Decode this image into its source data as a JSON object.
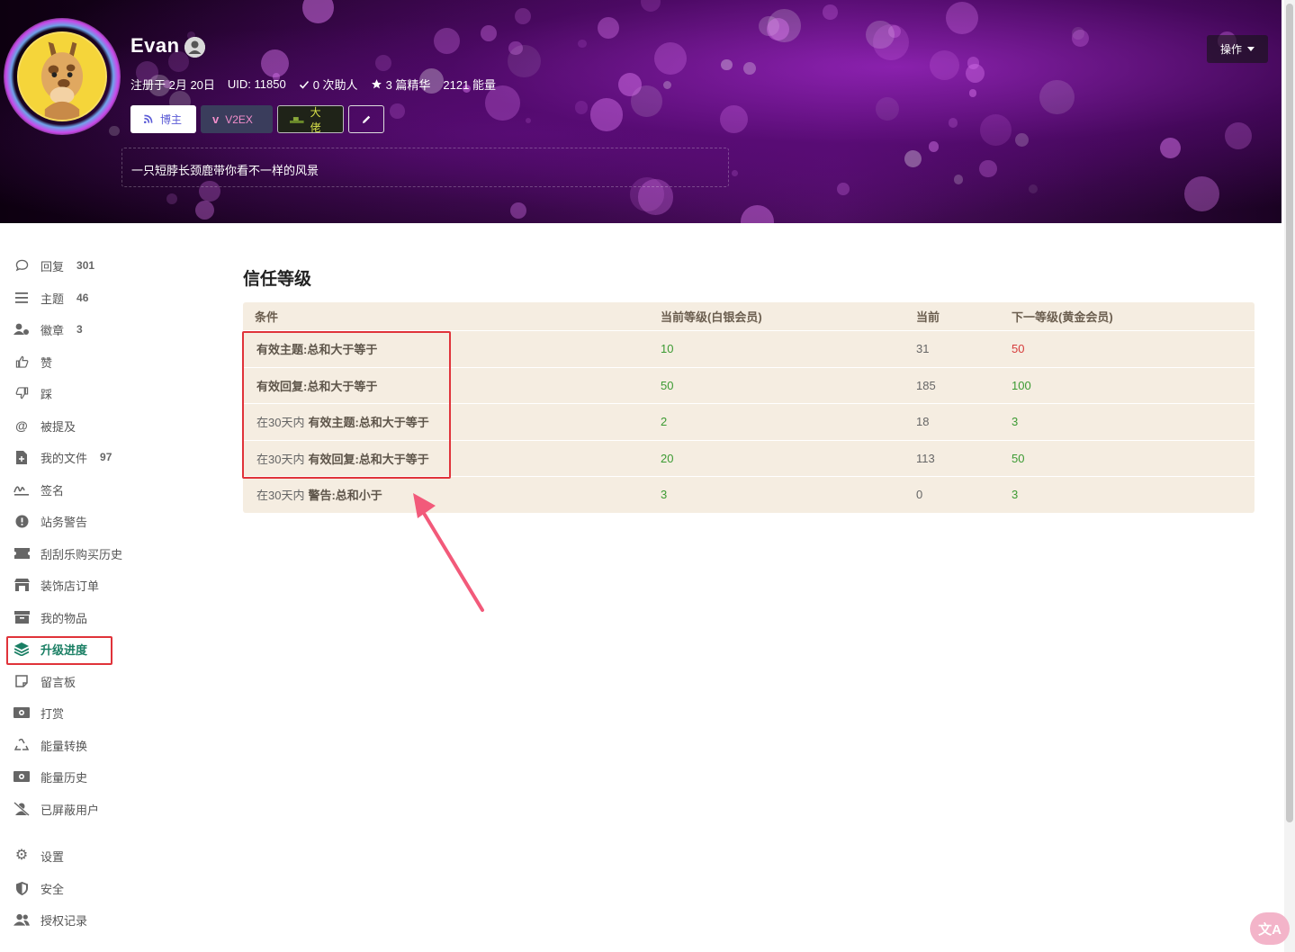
{
  "profile": {
    "name": "Evan",
    "registered": "注册于 2月 20日",
    "uid": "UID: 11850",
    "helped": "0 次助人",
    "featured": "3 篇精华",
    "energy": "2121 能量",
    "bio": "一只短脖长颈鹿带你看不一样的风景",
    "badges": {
      "blogger": "博主",
      "v2ex": "V2EX",
      "boss": "大佬"
    },
    "operations_label": "操作"
  },
  "sidebar": {
    "items": [
      {
        "label": "回复",
        "count": "301",
        "icon": "comment-icon"
      },
      {
        "label": "主题",
        "count": "46",
        "icon": "list-icon"
      },
      {
        "label": "徽章",
        "count": "3",
        "icon": "user-badge-icon"
      },
      {
        "label": "赞",
        "count": "",
        "icon": "thumbs-up-icon"
      },
      {
        "label": "踩",
        "count": "",
        "icon": "thumbs-down-icon"
      },
      {
        "label": "被提及",
        "count": "",
        "icon": "at-icon"
      },
      {
        "label": "我的文件",
        "count": "97",
        "icon": "file-icon"
      },
      {
        "label": "签名",
        "count": "",
        "icon": "signature-icon"
      },
      {
        "label": "站务警告",
        "count": "",
        "icon": "warning-icon"
      },
      {
        "label": "刮刮乐购买历史",
        "count": "",
        "icon": "ticket-icon"
      },
      {
        "label": "装饰店订单",
        "count": "",
        "icon": "store-icon"
      },
      {
        "label": "我的物品",
        "count": "",
        "icon": "box-icon"
      },
      {
        "label": "升级进度",
        "count": "",
        "icon": "layers-icon"
      },
      {
        "label": "留言板",
        "count": "",
        "icon": "note-icon"
      },
      {
        "label": "打赏",
        "count": "",
        "icon": "money-icon"
      },
      {
        "label": "能量转换",
        "count": "",
        "icon": "recycle-icon"
      },
      {
        "label": "能量历史",
        "count": "",
        "icon": "money-history-icon"
      },
      {
        "label": "已屏蔽用户",
        "count": "",
        "icon": "user-block-icon"
      },
      {
        "label": "设置",
        "count": "",
        "icon": "gear-icon"
      },
      {
        "label": "安全",
        "count": "",
        "icon": "shield-icon"
      },
      {
        "label": "授权记录",
        "count": "",
        "icon": "users-icon"
      }
    ],
    "active_index": 12
  },
  "trust": {
    "title": "信任等级",
    "headers": [
      "条件",
      "当前等级(白银会员)",
      "当前",
      "下一等级(黄金会员)"
    ],
    "rows": [
      {
        "prefix": "",
        "condition": "有效主题:总和大于等于",
        "level": "10",
        "current": "31",
        "next": "50",
        "next_color": "#d63b3b"
      },
      {
        "prefix": "",
        "condition": "有效回复:总和大于等于",
        "level": "50",
        "current": "185",
        "next": "100",
        "next_color": "#3b9a32"
      },
      {
        "prefix": "在30天内",
        "condition": "有效主题:总和大于等于",
        "level": "2",
        "current": "18",
        "next": "3",
        "next_color": "#3b9a32"
      },
      {
        "prefix": "在30天内",
        "condition": "有效回复:总和大于等于",
        "level": "20",
        "current": "113",
        "next": "50",
        "next_color": "#3b9a32"
      },
      {
        "prefix": "在30天内",
        "condition": "警告:总和小于",
        "level": "3",
        "current": "0",
        "next": "3",
        "next_color": "#3b9a32"
      }
    ]
  },
  "translate_label": "文A"
}
